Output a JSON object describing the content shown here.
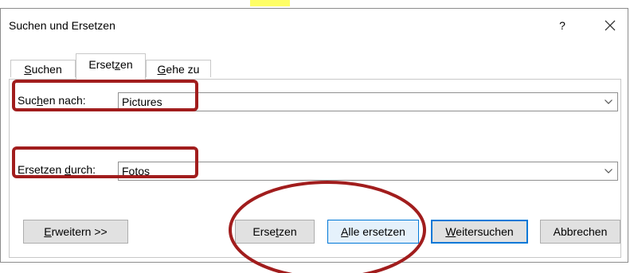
{
  "dialog": {
    "title": "Suchen und Ersetzen",
    "help_label": "?",
    "close_label": "×"
  },
  "tabs": [
    {
      "pre": "",
      "u": "S",
      "post": "uchen"
    },
    {
      "pre": "Erset",
      "u": "z",
      "post": "en"
    },
    {
      "pre": "",
      "u": "G",
      "post": "ehe zu"
    }
  ],
  "find": {
    "label_pre": "Suc",
    "label_u": "h",
    "label_post": "en nach:",
    "value": "Pictures"
  },
  "replace": {
    "label_pre": "Ersetzen ",
    "label_u": "d",
    "label_post": "urch:",
    "value": "Fotos"
  },
  "buttons": {
    "more": {
      "u": "E",
      "post": "rweitern >>"
    },
    "replace": {
      "pre": "Erse",
      "u": "t",
      "post": "zen"
    },
    "replace_all": {
      "u": "A",
      "post": "lle ersetzen"
    },
    "find_next": {
      "u": "W",
      "post": "eitersuchen"
    },
    "cancel": "Abbrechen"
  },
  "colors": {
    "annotation": "#a11d1d",
    "focus_border": "#0078d7",
    "highlight": "#ffff66"
  }
}
